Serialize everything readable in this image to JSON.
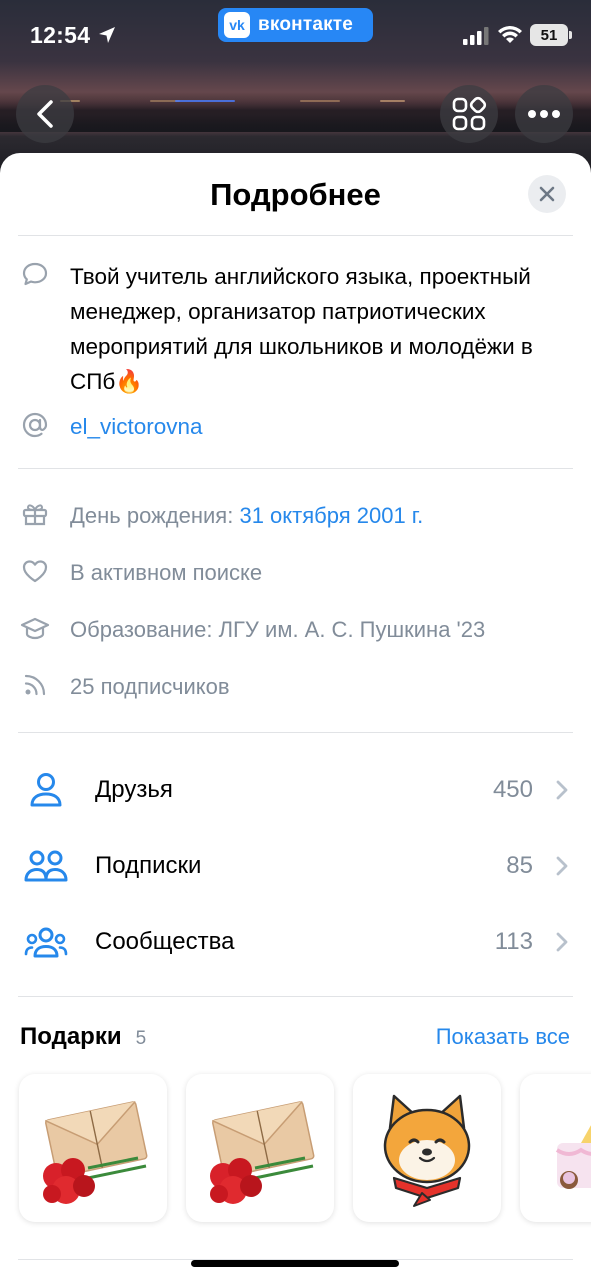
{
  "status_bar": {
    "time": "12:54",
    "app_badge": "вконтакте",
    "app_logo": "vk",
    "battery": "51"
  },
  "sheet": {
    "title": "Подробнее",
    "status": "Твой учитель английского языка, проектный менеджер, организатор патриотических мероприятий для школьников и молодёжи в СПб🔥",
    "nickname": "el_victorovna",
    "birthday_label": "День рождения: ",
    "birthday_value": "31 октября 2001 г.",
    "relationship": "В активном поиске",
    "education": "Образование: ЛГУ им. А. С. Пушкина '23",
    "followers": "25 подписчиков"
  },
  "counts": [
    {
      "label": "Друзья",
      "value": "450",
      "icon": "person-icon"
    },
    {
      "label": "Подписки",
      "value": "85",
      "icon": "people-icon"
    },
    {
      "label": "Сообщества",
      "value": "113",
      "icon": "communities-icon"
    }
  ],
  "gifts": {
    "title": "Подарки",
    "count": "5",
    "show_all": "Показать все",
    "items": [
      "envelope-with-carnations",
      "envelope-with-carnations",
      "shiba-dog-sticker",
      "cake-gift"
    ]
  },
  "colors": {
    "accent": "#2688eb",
    "vk_blue": "#2787f5",
    "secondary_text": "#818c99",
    "divider": "#e1e3e6"
  }
}
